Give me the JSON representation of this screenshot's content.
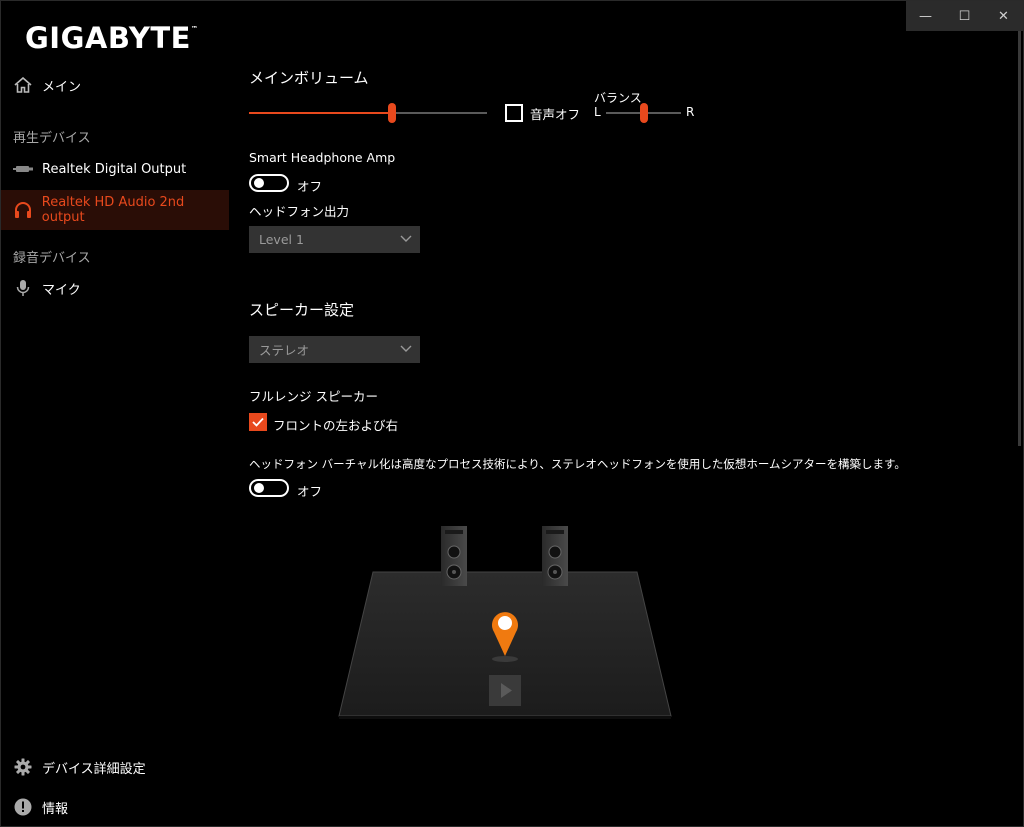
{
  "window": {
    "minimize": "—",
    "maximize": "☐",
    "close": "✕"
  },
  "sidebar": {
    "logo": "GIGABYTE",
    "logo_mark": "™",
    "main_label": "メイン",
    "playback_section": "再生デバイス",
    "playback_items": [
      {
        "label": "Realtek Digital Output"
      },
      {
        "label": "Realtek HD Audio 2nd output"
      }
    ],
    "recording_section": "録音デバイス",
    "recording_items": [
      {
        "label": "マイク"
      }
    ],
    "device_settings_label": "デバイス詳細設定",
    "info_label": "情報"
  },
  "main_volume": {
    "title": "メインボリューム",
    "level": 0.6,
    "mute_label": "音声オフ",
    "mute_checked": false,
    "balance_label": "バランス",
    "balance_left": "L",
    "balance_right": "R",
    "balance_value": 0.5
  },
  "smart_amp": {
    "title": "Smart Headphone Amp",
    "toggle_state": "オフ",
    "headphone_output_label": "ヘッドフォン出力",
    "headphone_output_value": "Level 1"
  },
  "speaker": {
    "title": "スピーカー設定",
    "config_value": "ステレオ",
    "full_range_label": "フルレンジ スピーカー",
    "front_lr_label": "フロントの左および右",
    "front_lr_checked": true
  },
  "virtualization": {
    "description": "ヘッドフォン バーチャル化は高度なプロセス技術により、ステレオヘッドフォンを使用した仮想ホームシアターを構築します。",
    "toggle_state": "オフ"
  },
  "colors": {
    "accent": "#e8491d",
    "active_bg": "#2a0d06",
    "dropdown_bg": "#333333"
  }
}
